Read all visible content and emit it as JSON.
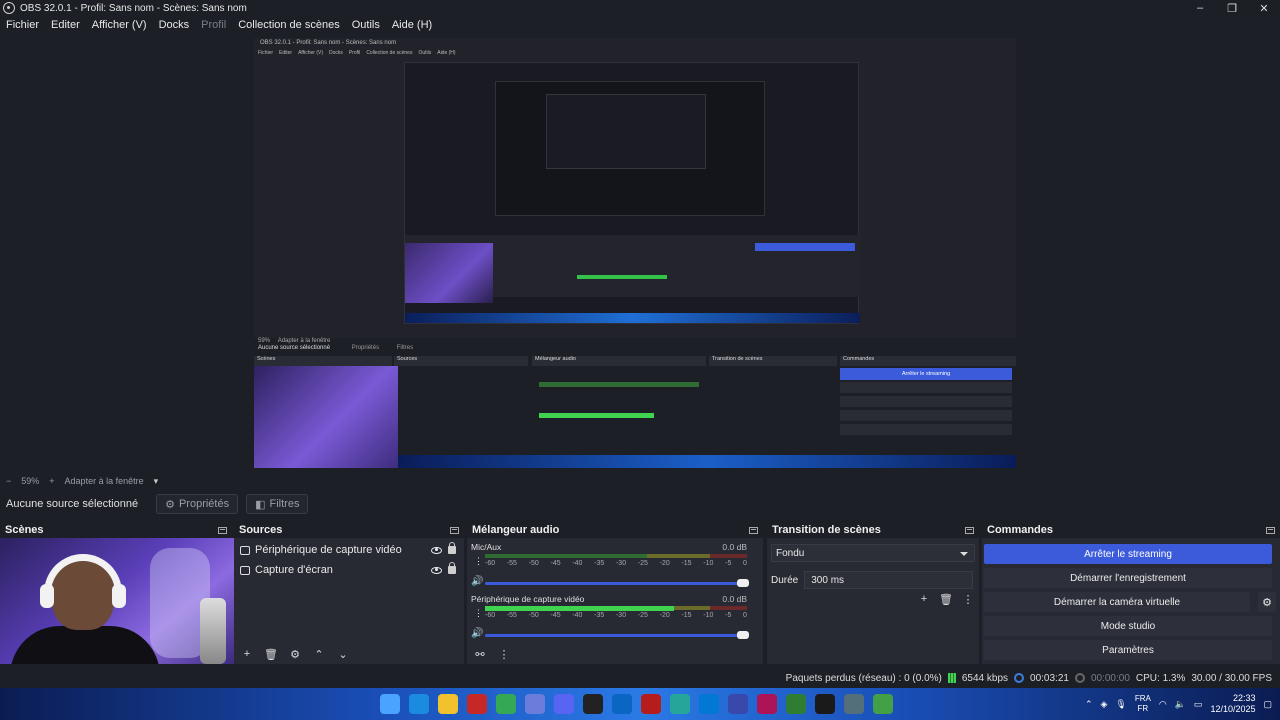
{
  "window": {
    "title": "OBS 32.0.1 - Profil: Sans nom - Scènes: Sans nom",
    "controls": [
      "–",
      "❐",
      "✕"
    ]
  },
  "menu": {
    "items": [
      {
        "label": "Fichier",
        "enabled": true
      },
      {
        "label": "Editer",
        "enabled": true
      },
      {
        "label": "Afficher (V)",
        "enabled": true
      },
      {
        "label": "Docks",
        "enabled": true
      },
      {
        "label": "Profil",
        "enabled": false
      },
      {
        "label": "Collection de scènes",
        "enabled": true
      },
      {
        "label": "Outils",
        "enabled": true
      },
      {
        "label": "Aide (H)",
        "enabled": true
      }
    ]
  },
  "nested": {
    "title": "OBS 32.0.1 - Profil: Sans nom - Scènes: Sans nom",
    "menu": [
      "Fichier",
      "Editer",
      "Afficher (V)",
      "Docks",
      "Profil",
      "Collection de scènes",
      "Outils",
      "Aide (H)"
    ],
    "zoom": "59%",
    "fit": "Adapter à la fenêtre",
    "no_source": "Aucune source sélectionné",
    "props": "Propriétés",
    "filters": "Filtres",
    "headers": [
      "Scènes",
      "Sources",
      "Mélangeur audio",
      "Transition de scènes",
      "Commandes"
    ],
    "stream_btn": "Arrêter le streaming"
  },
  "zoombar": {
    "minus": "−",
    "zoom": "59%",
    "plus": "+",
    "fit": "Adapter à la fenêtre"
  },
  "context": {
    "no_selection": "Aucune source sélectionné",
    "properties": "Propriétés",
    "filters": "Filtres"
  },
  "scenes": {
    "title": "Scènes"
  },
  "sources": {
    "title": "Sources",
    "items": [
      {
        "label": "Périphérique de capture vidéo",
        "visible": true,
        "locked": true
      },
      {
        "label": "Capture d'écran",
        "visible": true,
        "locked": true
      }
    ]
  },
  "mixer": {
    "title": "Mélangeur audio",
    "ticks": [
      "-60",
      "-55",
      "-50",
      "-45",
      "-40",
      "-35",
      "-30",
      "-25",
      "-20",
      "-15",
      "-10",
      "-5",
      "0"
    ],
    "channels": [
      {
        "name": "Mic/Aux",
        "db": "0.0 dB",
        "level": 0.0,
        "volume": 1.0
      },
      {
        "name": "Périphérique de capture vidéo",
        "db": "0.0 dB",
        "level": 0.72,
        "volume": 1.0
      }
    ]
  },
  "transitions": {
    "title": "Transition de scènes",
    "selected": "Fondu",
    "duration_label": "Durée",
    "duration_value": "300 ms"
  },
  "commands": {
    "title": "Commandes",
    "buttons": {
      "stream": "Arrêter le streaming",
      "record": "Démarrer l'enregistrement",
      "virtualcam": "Démarrer la caméra virtuelle",
      "studio": "Mode studio",
      "settings": "Paramètres"
    }
  },
  "status": {
    "dropped": "Paquets perdus (réseau) : 0 (0.0%)",
    "bitrate": "6544 kbps",
    "stream_time": "00:03:21",
    "rec_time": "00:00:00",
    "cpu": "CPU: 1.3%",
    "fps": "30.00 / 30.00 FPS"
  },
  "tray": {
    "lang_top": "FRA",
    "lang_bottom": "FR",
    "time": "22:33",
    "date": "12/10/2025"
  },
  "colors": {
    "accent": "#3b5bdb",
    "meter_green": "#3fd34f",
    "background": "#1d1f26",
    "dock": "#272a33"
  }
}
